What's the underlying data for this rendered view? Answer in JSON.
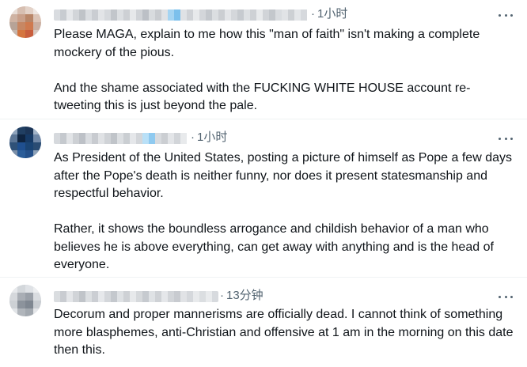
{
  "replies": [
    {
      "time": "1小时",
      "text": "Please MAGA, explain to me how this \"man of faith\" isn't making a complete mockery of the pious.\n\nAnd the shame associated with the FUCKING WHITE HOUSE account re-tweeting this is just beyond the pale."
    },
    {
      "time": "1小时",
      "text": "As President of the United States, posting a picture of himself as Pope a few days after the Pope's death is neither funny, nor does it present statesmanship and respectful behavior.\n\nRather, it shows the boundless arrogance and childish behavior of a man who believes he is above everything, can get away with anything and is the head of everyone."
    },
    {
      "time": "13分钟",
      "text": "Decorum and proper mannerisms are officially dead. I cannot think of something more blasphemes, anti-Christian and offensive at 1 am in the morning on this date then this."
    }
  ],
  "separator": "·",
  "icons": {
    "more": "more-horizontal-icon",
    "avatar": "pixelated-avatar"
  }
}
